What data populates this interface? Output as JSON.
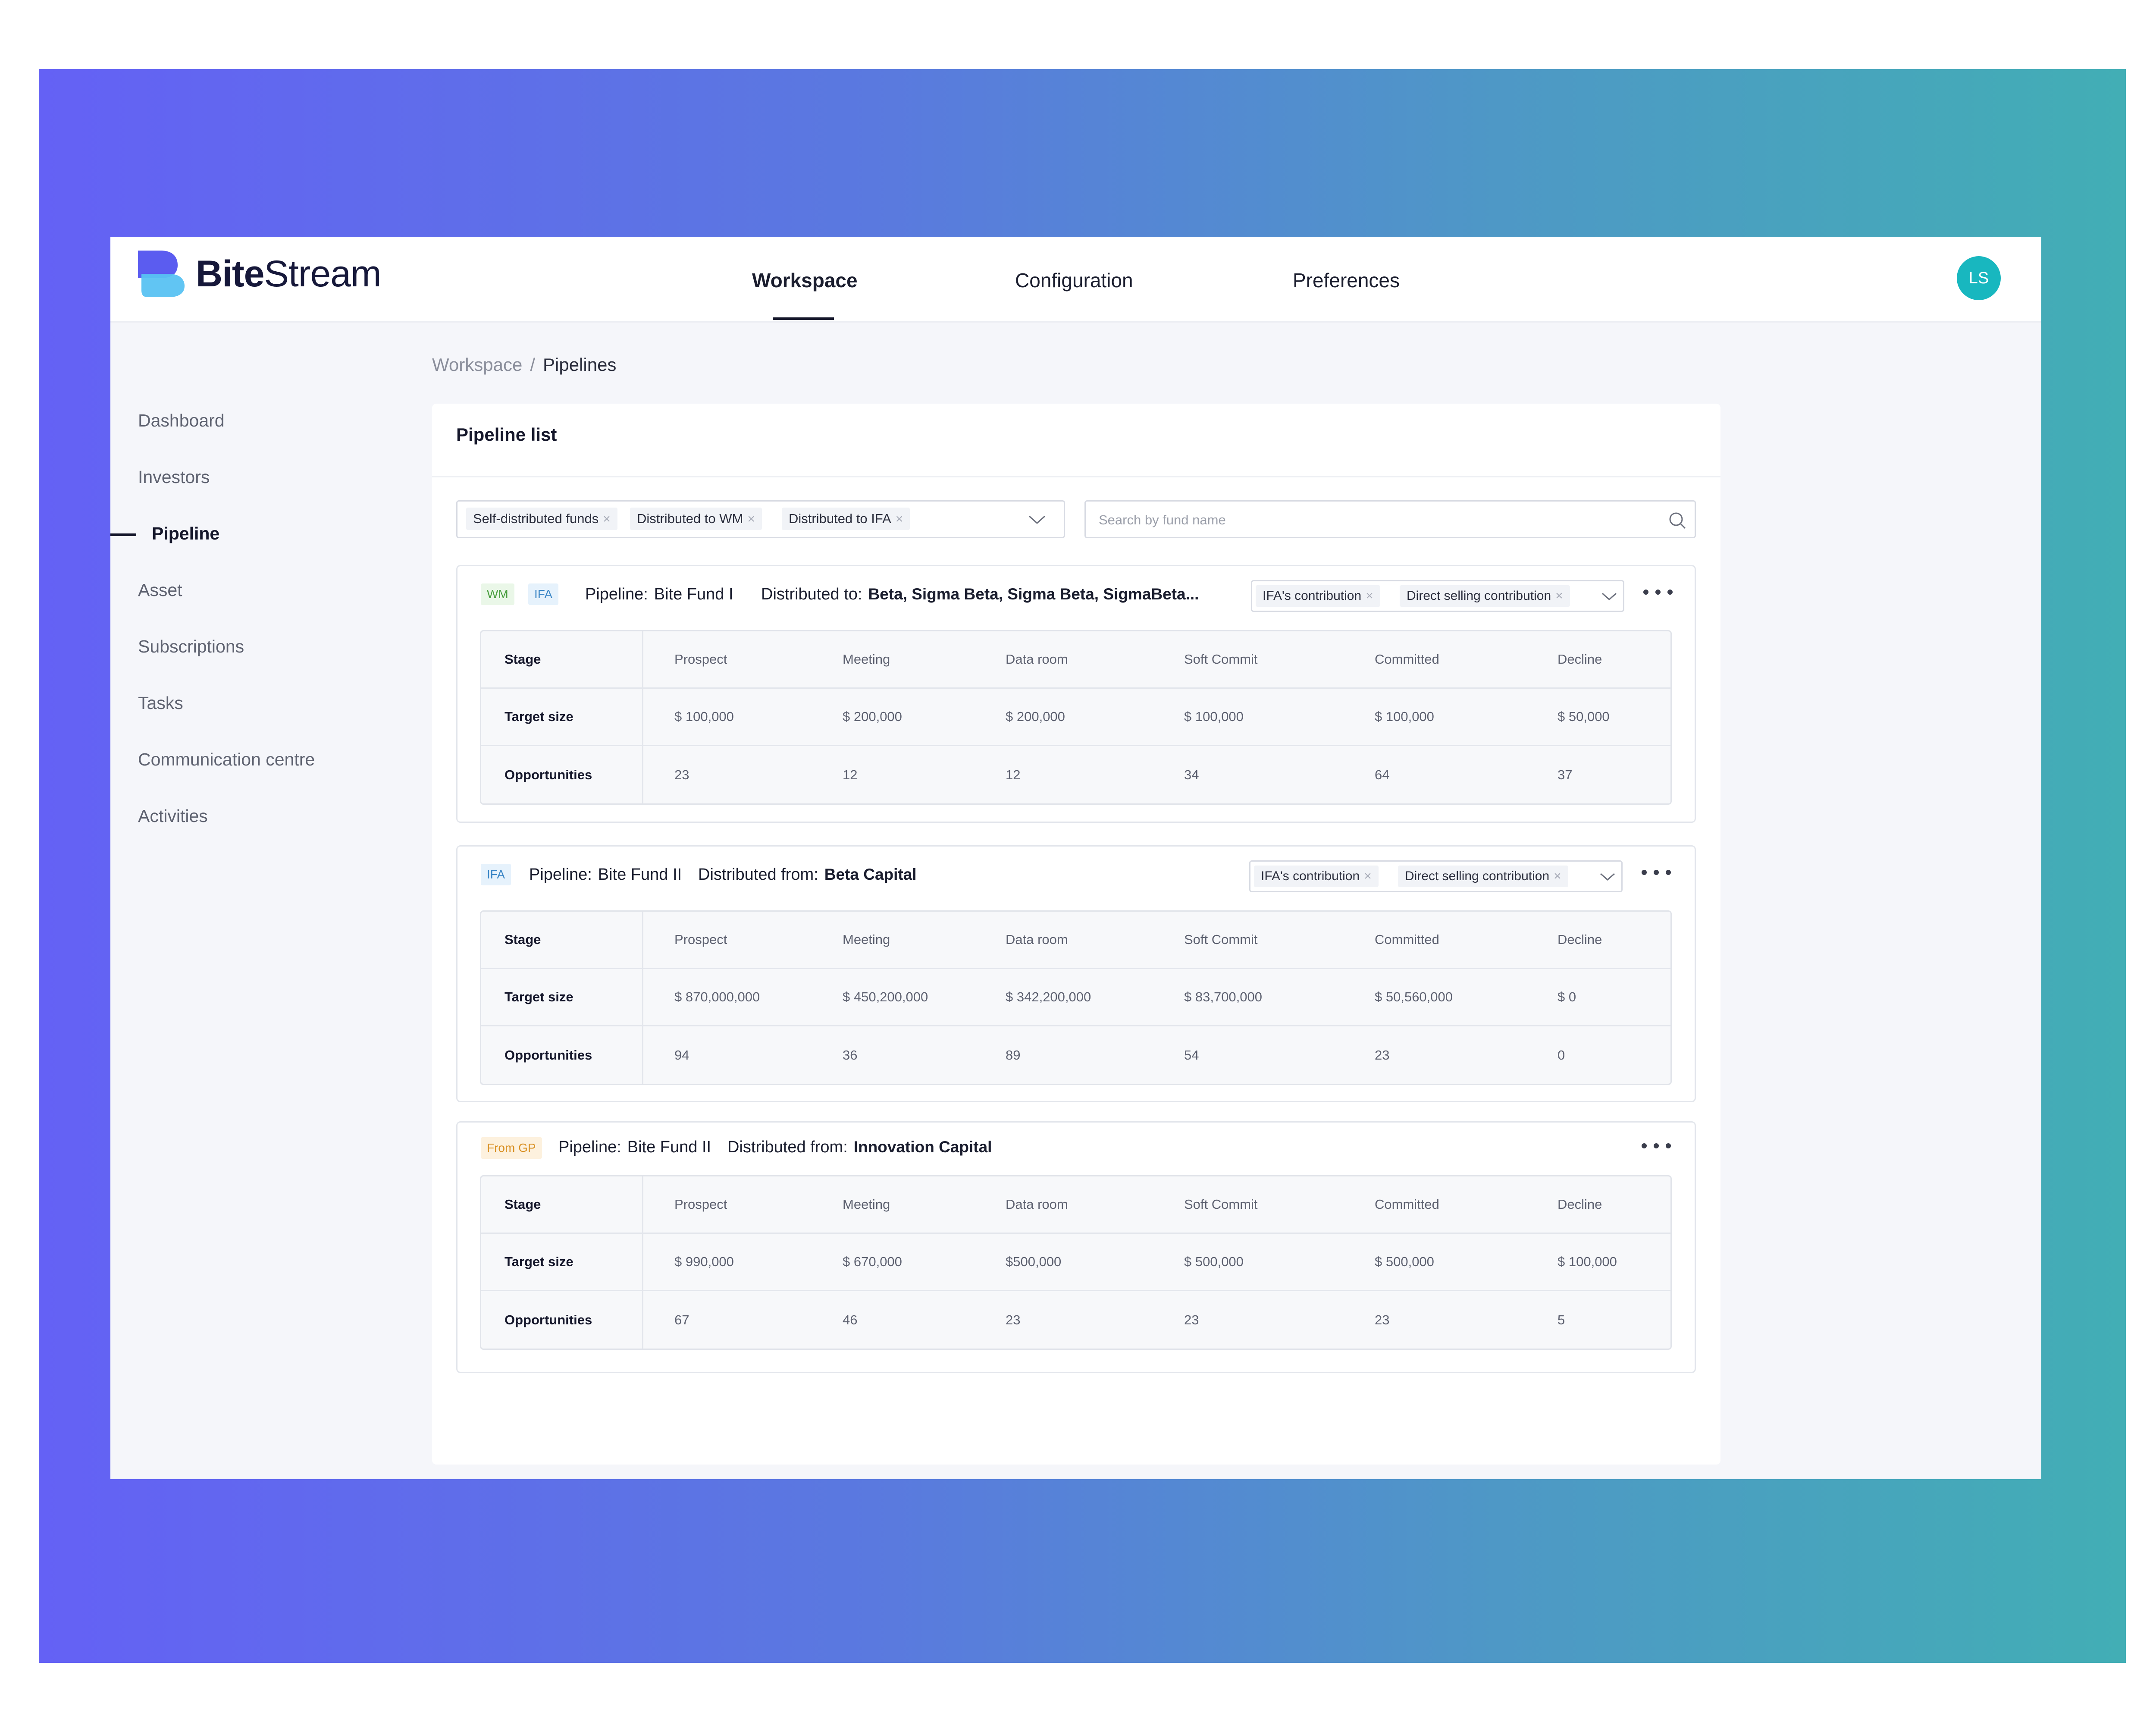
{
  "brand": {
    "name_bold": "Bite",
    "name_rest": "Stream"
  },
  "nav": {
    "tabs": [
      "Workspace",
      "Configuration",
      "Preferences"
    ],
    "active": "Workspace"
  },
  "user": {
    "initials": "LS"
  },
  "sidebar": {
    "items": [
      "Dashboard",
      "Investors",
      "Pipeline",
      "Asset",
      "Subscriptions",
      "Tasks",
      "Communication centre",
      "Activities"
    ],
    "active": "Pipeline"
  },
  "breadcrumb": {
    "parent": "Workspace",
    "separator": "/",
    "current": "Pipelines"
  },
  "panel": {
    "title": "Pipeline list",
    "filters": [
      "Self-distributed funds",
      "Distributed to WM",
      "Distributed to IFA"
    ],
    "search_placeholder": "Search by fund name"
  },
  "pipelines": [
    {
      "tags": [
        "WM",
        "IFA"
      ],
      "pipeline_label": "Pipeline:",
      "fund": "Bite Fund I",
      "dist_label": "Distributed to:",
      "dist_value": "Beta, Sigma  Beta, Sigma  Beta, SigmaBeta...",
      "contributions": [
        "IFA's contribution",
        "Direct selling contribution"
      ],
      "stages": [
        "Prospect",
        "Meeting",
        "Data room",
        "Soft Commit",
        "Committed",
        "Decline"
      ],
      "row_labels": [
        "Stage",
        "Target size",
        "Opportunities"
      ],
      "target_size": [
        "$ 100,000",
        "$ 200,000",
        "$ 200,000",
        "$ 100,000",
        "$ 100,000",
        "$ 50,000"
      ],
      "opportunities": [
        "23",
        "12",
        "12",
        "34",
        "64",
        "37"
      ]
    },
    {
      "tags": [
        "IFA"
      ],
      "pipeline_label": "Pipeline:",
      "fund": "Bite Fund II",
      "dist_label": "Distributed from:",
      "dist_value": "Beta Capital",
      "contributions": [
        "IFA's contribution",
        "Direct selling contribution"
      ],
      "stages": [
        "Prospect",
        "Meeting",
        "Data room",
        "Soft Commit",
        "Committed",
        "Decline"
      ],
      "row_labels": [
        "Stage",
        "Target size",
        "Opportunities"
      ],
      "target_size": [
        "$ 870,000,000",
        "$ 450,200,000",
        "$ 342,200,000",
        "$ 83,700,000",
        "$ 50,560,000",
        "$ 0"
      ],
      "opportunities": [
        "94",
        "36",
        "89",
        "54",
        "23",
        "0"
      ]
    },
    {
      "tags": [
        "From GP"
      ],
      "pipeline_label": "Pipeline:",
      "fund": "Bite Fund II",
      "dist_label": "Distributed from:",
      "dist_value": "Innovation Capital",
      "contributions": [],
      "stages": [
        "Prospect",
        "Meeting",
        "Data room",
        "Soft Commit",
        "Committed",
        "Decline"
      ],
      "row_labels": [
        "Stage",
        "Target size",
        "Opportunities"
      ],
      "target_size": [
        "$ 990,000",
        "$ 670,000",
        "$500,000",
        "$ 500,000",
        "$ 500,000",
        "$ 100,000"
      ],
      "opportunities": [
        "67",
        "46",
        "23",
        "23",
        "23",
        "5"
      ]
    }
  ]
}
